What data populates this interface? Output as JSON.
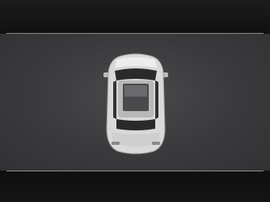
{
  "screen": {
    "mode": "top-down-vehicle-view",
    "colors": {
      "background": "#131313",
      "view_area": "#3c3c3e",
      "boundary_line": "#8a8a8a",
      "vehicle_body": "#d8d8d8"
    }
  },
  "vehicle": {
    "icon": "car-top-view-icon"
  }
}
